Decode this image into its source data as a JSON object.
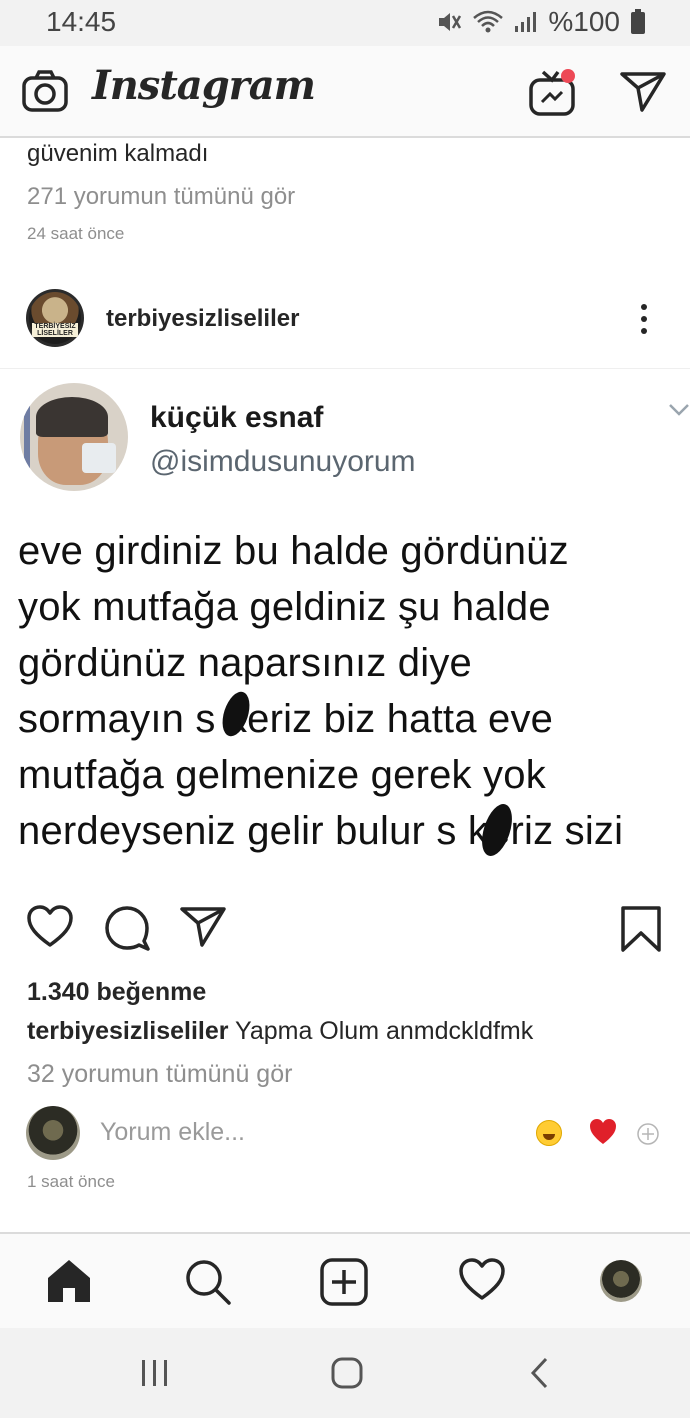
{
  "status_bar": {
    "time": "14:45",
    "battery": "%100",
    "icons": [
      "mute-icon",
      "wifi-icon",
      "signal-icon",
      "battery-icon"
    ]
  },
  "app_header": {
    "logo": "Instagram",
    "icons": [
      "camera-icon",
      "igtv-icon",
      "direct-message-icon"
    ],
    "notification_dot_color": "#ed4956"
  },
  "previous_post": {
    "caption_tail": "güvenim kalmadı",
    "view_comments": "271 yorumun tümünü gör",
    "time": "24 saat önce"
  },
  "post": {
    "username": "terbiyesizliseliler",
    "avatar_label": "TERBİYESİZ LİSELİLER",
    "image": {
      "tweet_name": "küçük esnaf",
      "tweet_handle": "@isimdusunuyorum",
      "tweet_lines": [
        "eve girdiniz bu halde gördünüz",
        "yok mutfağa geldiniz şu halde",
        "gördünüz naparsınız diye",
        "sormayın s keriz biz hatta eve",
        "mutfağa gelmenize gerek yok",
        "nerdeyseniz gelir bulur s keriz sizi"
      ]
    },
    "likes": "1.340 beğenme",
    "caption_user": "terbiyesizliseliler",
    "caption_text": " Yapma Olum anmdckldfmk",
    "view_comments": "32 yorumun tümünü gör",
    "comment_placeholder": "Yorum ekle...",
    "time": "1 saat önce"
  },
  "bottom_nav": [
    "home-icon",
    "search-icon",
    "new-post-icon",
    "activity-icon",
    "profile-icon"
  ],
  "system_nav": [
    "recent-apps-icon",
    "home-button-icon",
    "back-icon"
  ]
}
